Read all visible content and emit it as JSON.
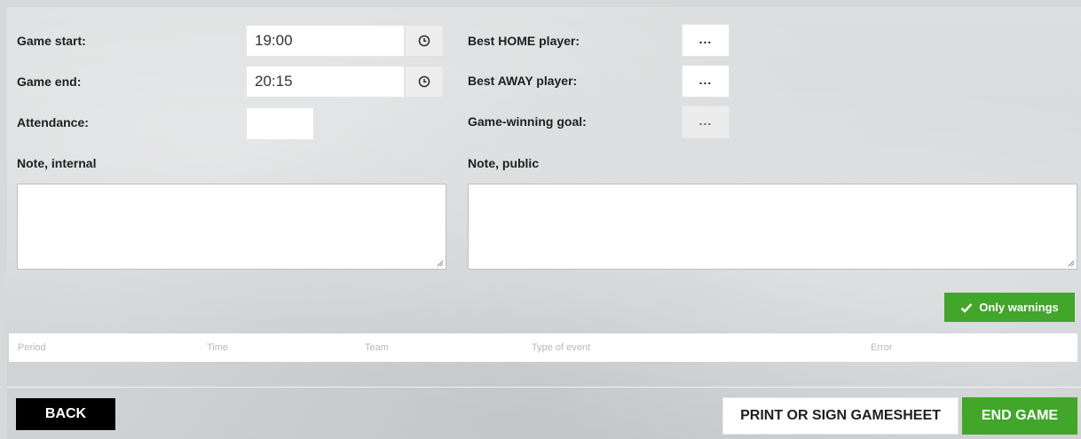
{
  "fields": {
    "game_start_label": "Game start:",
    "game_start_value": "19:00",
    "game_end_label": "Game end:",
    "game_end_value": "20:15",
    "attendance_label": "Attendance:",
    "attendance_value": "",
    "best_home_label": "Best HOME player:",
    "best_away_label": "Best AWAY player:",
    "winning_goal_label": "Game-winning goal:",
    "picker_label": "...",
    "note_internal_label": "Note, internal",
    "note_public_label": "Note, public",
    "note_internal_value": "",
    "note_public_value": ""
  },
  "filter": {
    "only_warnings_label": "Only warnings",
    "icon": "checkmark-icon"
  },
  "table": {
    "columns": [
      "Period",
      "Time",
      "Team",
      "Type of event",
      "Error"
    ]
  },
  "footer": {
    "back_label": "BACK",
    "print_label": "PRINT OR SIGN GAMESHEET",
    "end_label": "END GAME"
  },
  "colors": {
    "green": "#41a62a",
    "black": "#000000"
  }
}
